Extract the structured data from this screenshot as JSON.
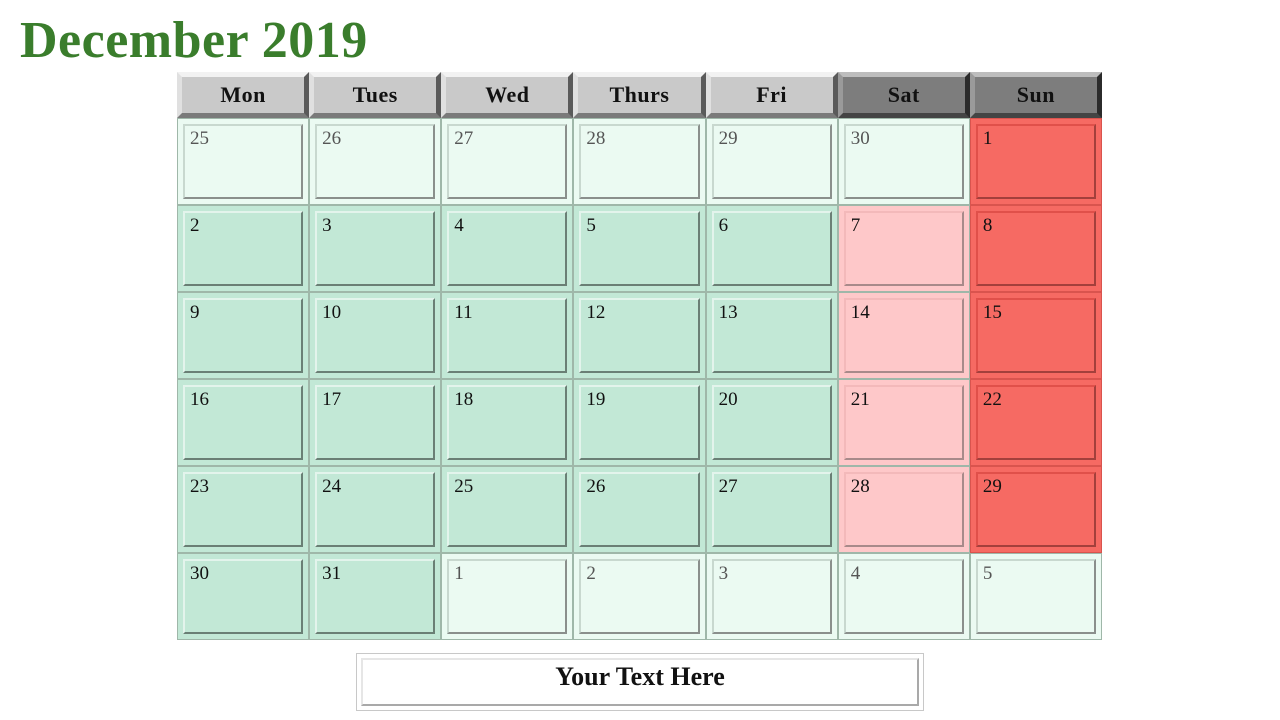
{
  "title": "December 2019",
  "colors": {
    "title": "#3a7d2c",
    "header_weekday": "#c9c9c9",
    "header_weekend": "#7d7d7d",
    "outside_month": "#ebfaf2",
    "weekday": "#c2e8d6",
    "saturday": "#fec8c9",
    "sunday": "#f66a63"
  },
  "headers": [
    "Mon",
    "Tues",
    "Wed",
    "Thurs",
    "Fri",
    "Sat",
    "Sun"
  ],
  "weeks": [
    [
      "25",
      "26",
      "27",
      "28",
      "29",
      "30",
      "1"
    ],
    [
      "2",
      "3",
      "4",
      "5",
      "6",
      "7",
      "8"
    ],
    [
      "9",
      "10",
      "11",
      "12",
      "13",
      "14",
      "15"
    ],
    [
      "16",
      "17",
      "18",
      "19",
      "20",
      "21",
      "22"
    ],
    [
      "23",
      "24",
      "25",
      "26",
      "27",
      "28",
      "29"
    ],
    [
      "30",
      "31",
      "1",
      "2",
      "3",
      "4",
      "5"
    ]
  ],
  "cell_types": [
    [
      "outside",
      "outside",
      "outside",
      "outside",
      "outside",
      "outside",
      "sun"
    ],
    [
      "weekday",
      "weekday",
      "weekday",
      "weekday",
      "weekday",
      "sat",
      "sun"
    ],
    [
      "weekday",
      "weekday",
      "weekday",
      "weekday",
      "weekday",
      "sat",
      "sun"
    ],
    [
      "weekday",
      "weekday",
      "weekday",
      "weekday",
      "weekday",
      "sat",
      "sun"
    ],
    [
      "weekday",
      "weekday",
      "weekday",
      "weekday",
      "weekday",
      "sat",
      "sun"
    ],
    [
      "weekday",
      "weekday",
      "outside",
      "outside",
      "outside",
      "outside",
      "outside"
    ]
  ],
  "footer_text": "Your Text Here"
}
